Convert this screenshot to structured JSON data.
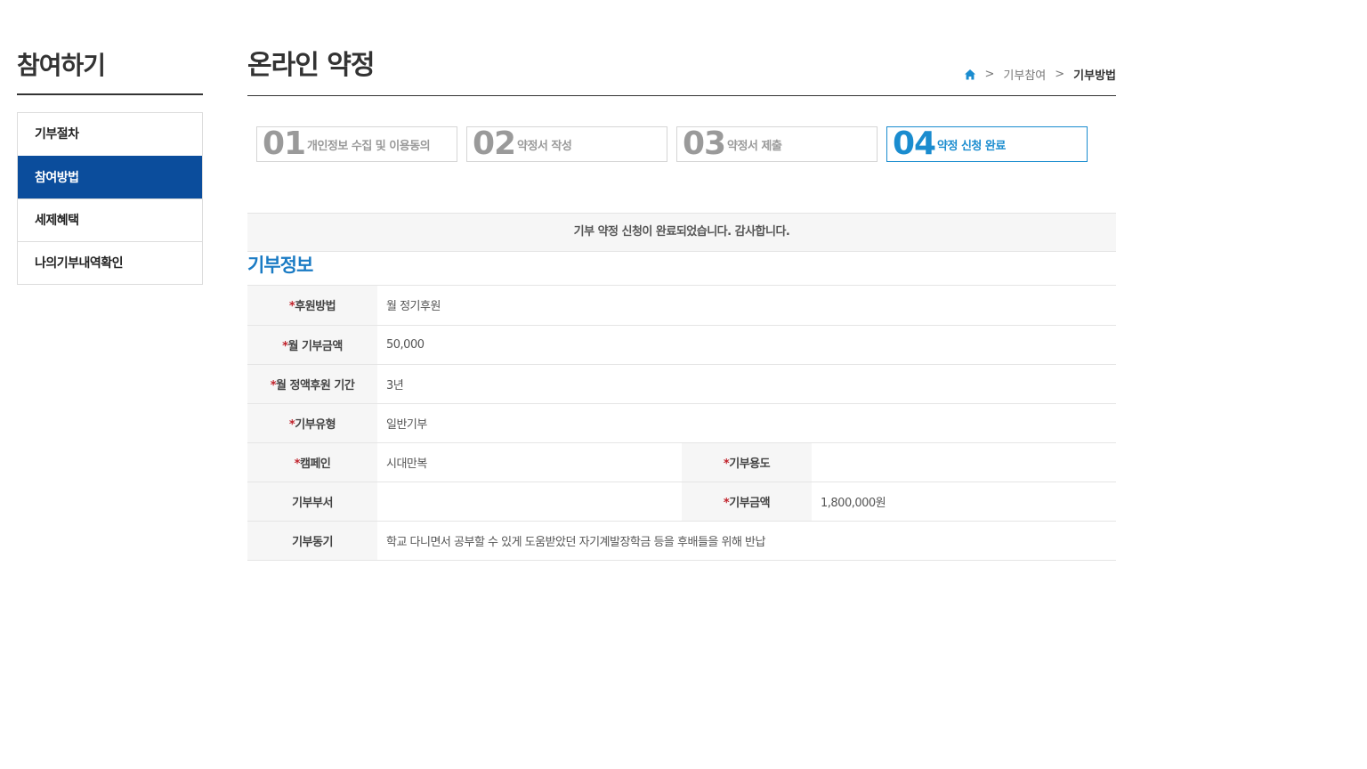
{
  "sidebar": {
    "title": "참여하기",
    "items": [
      {
        "label": "기부절차"
      },
      {
        "label": "참여방법"
      },
      {
        "label": "세제혜택"
      },
      {
        "label": "나의기부내역확인"
      }
    ]
  },
  "header": {
    "title": "온라인 약정",
    "breadcrumb": {
      "home_icon": "home-icon",
      "sep": ">",
      "items": [
        "기부참여",
        "기부방법"
      ]
    }
  },
  "steps": [
    {
      "num": "01",
      "label": "개인정보 수집 및 이용동의"
    },
    {
      "num": "02",
      "label": "약정서 작성"
    },
    {
      "num": "03",
      "label": "약정서 제출"
    },
    {
      "num": "04",
      "label": "약정 신청 완료"
    }
  ],
  "notice": "기부 약정 신청이 완료되었습니다. 감사합니다.",
  "section_title": "기부정보",
  "required_mark": "*",
  "info": {
    "method": {
      "label": "후원방법",
      "value": "월 정기후원"
    },
    "monthly_amount": {
      "label": "월 기부금액",
      "value": "50,000"
    },
    "period": {
      "label": "월 정액후원 기간",
      "value": "3년"
    },
    "type": {
      "label": "기부유형",
      "value": "일반기부"
    },
    "campaign": {
      "label": "캠페인",
      "value": "시대만복"
    },
    "usage": {
      "label": "기부용도",
      "value": ""
    },
    "department": {
      "label": "기부부서",
      "value": ""
    },
    "amount": {
      "label": "기부금액",
      "value": "1,800,000원"
    },
    "motive": {
      "label": "기부동기",
      "value": "학교 다니면서 공부할 수 있게 도움받았던 자기계발장학금 등을 후배들을 위해 반납"
    }
  },
  "colors": {
    "accent_blue": "#1a8ccf",
    "nav_active": "#0b4d9c",
    "section_title": "#1a7bc4",
    "required": "#c0222b"
  }
}
